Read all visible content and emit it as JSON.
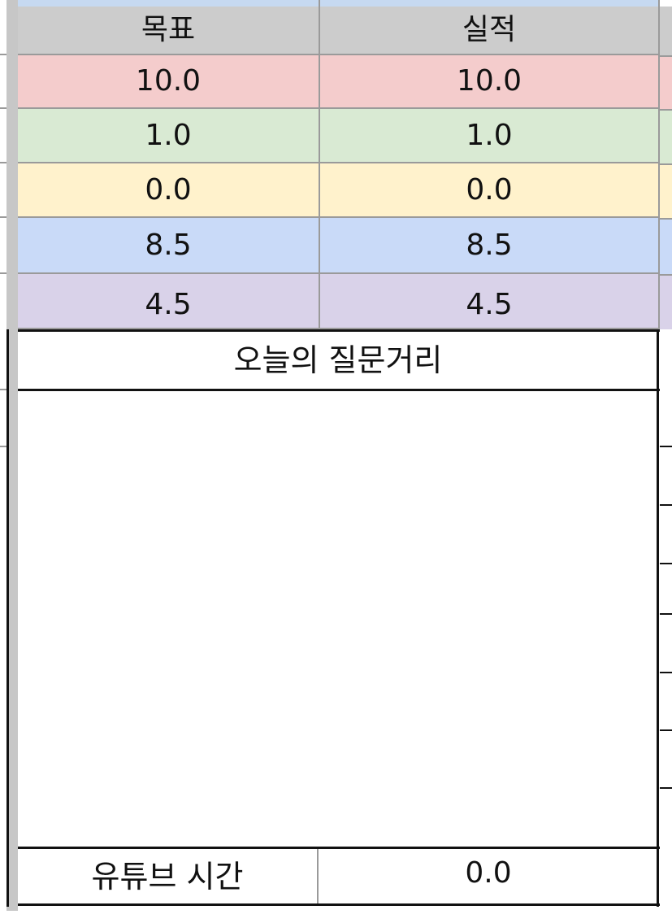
{
  "table": {
    "header": {
      "target": "목표",
      "actual": "실적"
    },
    "rows": [
      {
        "target": "10.0",
        "actual": "10.0",
        "color": "#f4cccc"
      },
      {
        "target": "1.0",
        "actual": "1.0",
        "color": "#d9ead3"
      },
      {
        "target": "0.0",
        "actual": "0.0",
        "color": "#fff2cc"
      },
      {
        "target": "8.5",
        "actual": "8.5",
        "color": "#c9daf8"
      },
      {
        "target": "4.5",
        "actual": "4.5",
        "color": "#d9d2e9"
      }
    ],
    "header_color": "#cccccc"
  },
  "question": {
    "title": "오늘의 질문거리",
    "answer": ""
  },
  "youtube": {
    "label": "유튜브 시간",
    "value": "0.0"
  }
}
